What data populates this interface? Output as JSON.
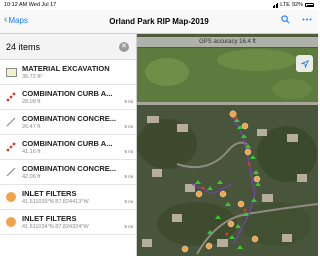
{
  "status": {
    "time": "10:12 AM  Wed Jul 17",
    "network": "LTE",
    "battery": "92%"
  },
  "nav": {
    "back_label": "Maps",
    "title": "Orland Park RIP Map-2019"
  },
  "list": {
    "count": "24 items",
    "items": [
      {
        "symbol": "square",
        "title": "MATERIAL EXCAVATION",
        "sub": "35.72 ft²",
        "dist": ""
      },
      {
        "symbol": "red-dots",
        "title": "COMBINATION CURB A...",
        "sub": "28.09 ft",
        "dist": "5 mi"
      },
      {
        "symbol": "gray-line",
        "title": "COMBINATION CONCRE...",
        "sub": "26.47 ft",
        "dist": "5 mi"
      },
      {
        "symbol": "red-dots",
        "title": "COMBINATION CURB A...",
        "sub": "41.16 ft",
        "dist": "5 mi"
      },
      {
        "symbol": "gray-line",
        "title": "COMBINATION CONCRE...",
        "sub": "42.06 ft",
        "dist": "5 mi"
      },
      {
        "symbol": "orange-dot",
        "title": "INLET FILTERS",
        "sub": "41.611039°N  87.824413°W",
        "dist": "5 mi"
      },
      {
        "symbol": "orange-dot",
        "title": "INLET FILTERS",
        "sub": "41.611034°N  87.824324°W",
        "dist": "5 mi"
      }
    ]
  },
  "map": {
    "gps_accuracy": "GPS accuracy 16.4 ft"
  },
  "colors": {
    "accent": "#1a7ef5",
    "inlet": "#f2a34a",
    "curb": "#d83a2a",
    "green_marker": "#2fcf2f"
  }
}
